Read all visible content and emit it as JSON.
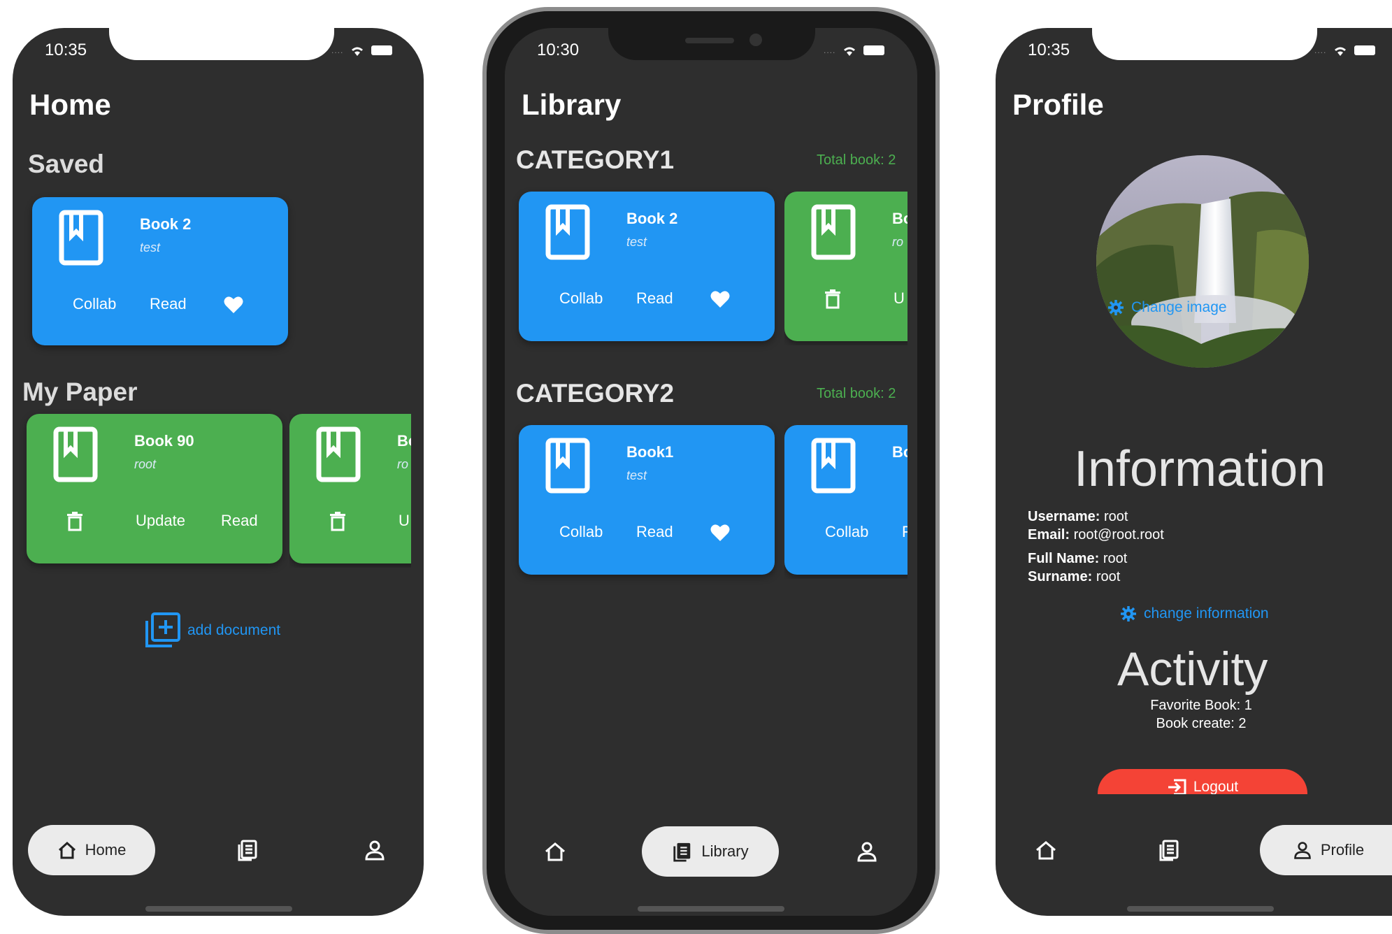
{
  "colors": {
    "background": "#2e2e2e",
    "blue": "#2196f3",
    "green": "#4caf50",
    "red": "#f44336",
    "pill": "#ebebeb"
  },
  "screen1": {
    "time": "10:35",
    "title": "Home",
    "saved_label": "Saved",
    "saved_card": {
      "title": "Book 2",
      "subtitle": "test",
      "btn_collab": "Collab",
      "btn_read": "Read",
      "icon": "heart-icon"
    },
    "mypaper_label": "My Paper",
    "paper_card1": {
      "title": "Book 90",
      "subtitle": "root",
      "btn_update": "Update",
      "btn_read": "Read"
    },
    "paper_card2": {
      "title": "Bo",
      "subtitle": "ro",
      "btn_update": "U"
    },
    "add_document": "add document",
    "nav": {
      "home": "Home"
    }
  },
  "screen2": {
    "time": "10:30",
    "title": "Library",
    "categories": [
      {
        "name": "CATEGORY1",
        "total": "Total book: 2",
        "card1": {
          "title": "Book 2",
          "subtitle": "test",
          "btn_collab": "Collab",
          "btn_read": "Read"
        },
        "card2": {
          "title": "Bo",
          "subtitle": "ro",
          "btn2": "U"
        }
      },
      {
        "name": "CATEGORY2",
        "total": "Total book: 2",
        "card1": {
          "title": "Book1",
          "subtitle": "test",
          "btn_collab": "Collab",
          "btn_read": "Read"
        },
        "card2": {
          "title": "Bo",
          "btn_collab": "Collab",
          "btn2": "F"
        }
      }
    ],
    "nav": {
      "library": "Library"
    }
  },
  "screen3": {
    "time": "10:35",
    "title": "Profile",
    "change_image": "Change image",
    "information": "Information",
    "username_label": "Username:",
    "username": "root",
    "email_label": "Email:",
    "email": "root@root.root",
    "fullname_label": "Full Name:",
    "fullname": "root",
    "surname_label": "Surname:",
    "surname": "root",
    "change_information": "change information",
    "activity": "Activity",
    "favorite": "Favorite Book: 1",
    "created": "Book create: 2",
    "logout": "Logout",
    "nav": {
      "profile": "Profile"
    }
  }
}
